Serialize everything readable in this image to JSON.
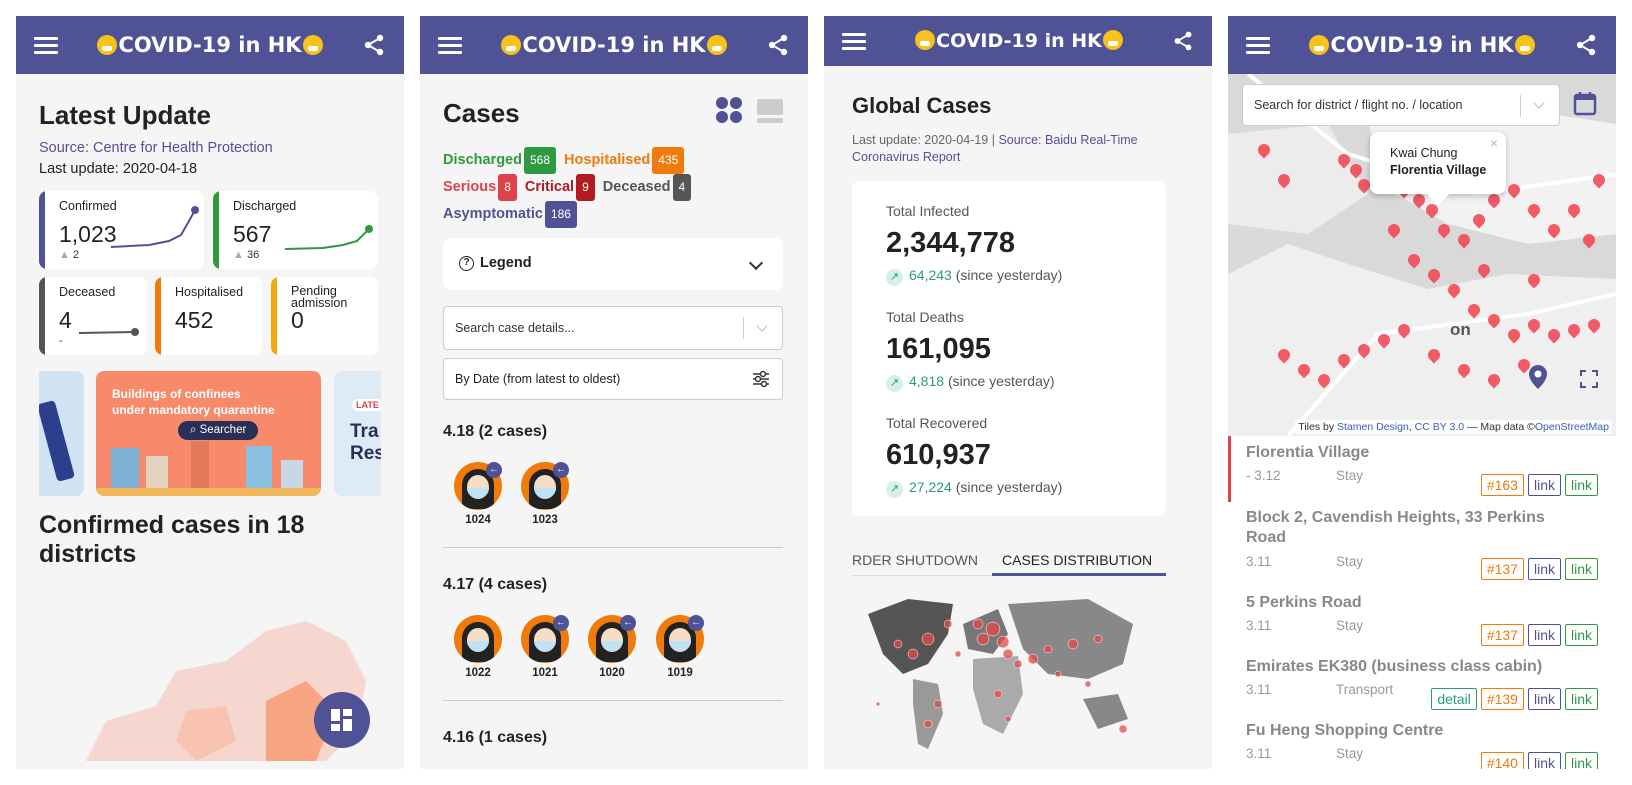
{
  "app": {
    "title": "COVID-19 in HK"
  },
  "panel1": {
    "heading": "Latest Update",
    "source": "Source: Centre for Health Protection",
    "last_update": "Last update: 2020-04-18",
    "stats": [
      {
        "label": "Confirmed",
        "value": "1,023",
        "delta": "2",
        "color": "#505296"
      },
      {
        "label": "Discharged",
        "value": "567",
        "delta": "36",
        "color": "#2e9a3f"
      },
      {
        "label": "Deceased",
        "value": "4",
        "delta": "-",
        "color": "#555555"
      },
      {
        "label": "Hospitalised",
        "value": "452",
        "color": "#f07a0a"
      },
      {
        "label": "Pending admission",
        "value": "0",
        "color": "#f0a80a"
      }
    ],
    "banner": {
      "line1": "Buildings of confinees",
      "line2": "under mandatory quarantine",
      "button": "Searcher",
      "side_label": "LATE",
      "side_text1": "Tra",
      "side_text2": "Res"
    },
    "districts_heading": "Confirmed cases in 18 districts"
  },
  "panel2": {
    "heading": "Cases",
    "summary": [
      {
        "label": "Discharged",
        "count": "568",
        "color": "#2e9a3f"
      },
      {
        "label": "Hospitalised",
        "count": "435",
        "color": "#f07a0a"
      },
      {
        "label": "Serious",
        "count": "8",
        "color": "#e0424b"
      },
      {
        "label": "Critical",
        "count": "9",
        "color": "#b01c22"
      },
      {
        "label": "Deceased",
        "count": "4",
        "color": "#555555"
      },
      {
        "label": "Asymptomatic",
        "count": "186",
        "color": "#505296"
      }
    ],
    "legend_label": "Legend",
    "search_placeholder": "Search case details...",
    "sort_label": "By Date (from latest to oldest)",
    "groups": [
      {
        "title": "4.18 (2 cases)",
        "cases": [
          "1024",
          "1023"
        ]
      },
      {
        "title": "4.17 (4 cases)",
        "cases": [
          "1022",
          "1021",
          "1020",
          "1019"
        ]
      },
      {
        "title": "4.16 (1 cases)",
        "cases": []
      }
    ]
  },
  "panel3": {
    "heading": "Global Cases",
    "last_update": "Last update: 2020-04-19 |",
    "source": "Source: Baidu Real-Time Coronavirus Report",
    "stats": [
      {
        "label": "Total Infected",
        "value": "2,344,778",
        "delta": "64,243",
        "suffix": "(since yesterday)"
      },
      {
        "label": "Total Deaths",
        "value": "161,095",
        "delta": "4,818",
        "suffix": "(since yesterday)"
      },
      {
        "label": "Total Recovered",
        "value": "610,937",
        "delta": "27,224",
        "suffix": "(since yesterday)"
      }
    ],
    "tabs": [
      "RDER SHUTDOWN",
      "CASES DISTRIBUTION"
    ]
  },
  "panel4": {
    "search_placeholder": "Search for district / flight no. / location",
    "popup": {
      "district": "Kwai Chung",
      "place": "Florentia Village"
    },
    "map_label": "on",
    "attribution": {
      "prefix": "Tiles by ",
      "stamen": "Stamen Design",
      "sep": ", ",
      "cc": "CC BY 3.0",
      "rest": " — Map data ©",
      "osm": "OpenStreetMap"
    },
    "locations": [
      {
        "name": "Florentia Village",
        "date": "- 3.12",
        "type": "Stay",
        "tags": [
          "#163",
          "link",
          "link"
        ]
      },
      {
        "name": "Block 2, Cavendish Heights, 33 Perkins Road",
        "date": "3.11",
        "type": "Stay",
        "tags": [
          "#137",
          "link",
          "link"
        ]
      },
      {
        "name": "5 Perkins Road",
        "date": "3.11",
        "type": "Stay",
        "tags": [
          "#137",
          "link",
          "link"
        ]
      },
      {
        "name": "Emirates EK380 (business class cabin)",
        "date": "3.11",
        "type": "Transport",
        "tags": [
          "detail",
          "#139",
          "link",
          "link"
        ]
      },
      {
        "name": "Fu Heng Shopping Centre",
        "date": "3.11",
        "type": "Stay",
        "tags": [
          "#140",
          "link",
          "link"
        ]
      }
    ]
  }
}
